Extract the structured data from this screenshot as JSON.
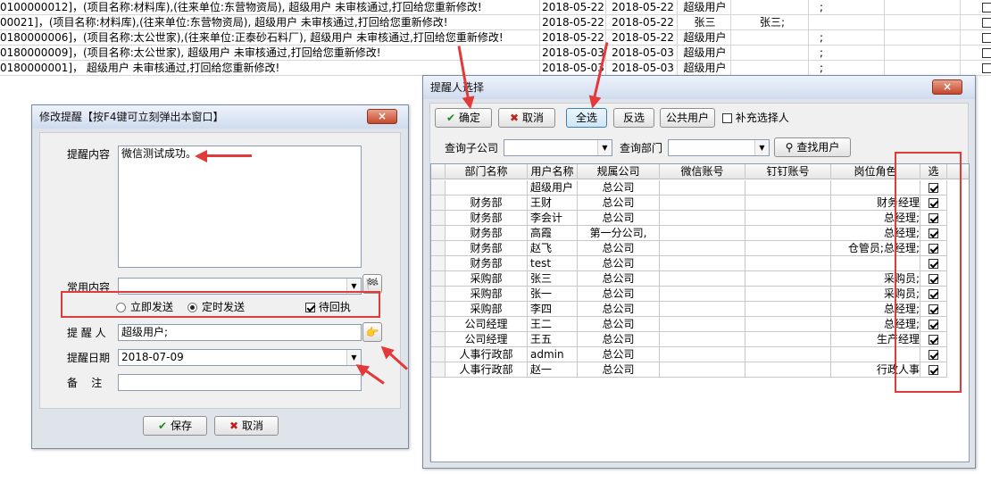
{
  "background": {
    "rows": [
      {
        "text": "0100000012]，(项目名称:材料库),(往来单位:东营物资局), 超级用户 未审核通过,打回给您重新修改!",
        "d1": "2018-05-22",
        "d2": "2018-05-22",
        "user": "超级用户",
        "c5": "",
        "c6": ";"
      },
      {
        "text": "00021]，(项目名称:材料库),(往来单位:东营物资局), 超级用户 未审核通过,打回给您重新修改!",
        "d1": "2018-05-22",
        "d2": "2018-05-22",
        "user": "张三",
        "c5": "张三;",
        "c6": ""
      },
      {
        "text": "0180000006]，(项目名称:太公世家),(往来单位:正泰砂石料厂), 超级用户 未审核通过,打回给您重新修改!",
        "d1": "2018-05-22",
        "d2": "2018-05-22",
        "user": "超级用户",
        "c5": "",
        "c6": ";"
      },
      {
        "text": "0180000009]，(项目名称:太公世家), 超级用户 未审核通过,打回给您重新修改!",
        "d1": "2018-05-03",
        "d2": "2018-05-03",
        "user": "超级用户",
        "c5": "",
        "c6": ";"
      },
      {
        "text": "0180000001]， 超级用户 未审核通过,打回给您重新修改!",
        "d1": "2018-05-03",
        "d2": "2018-05-03",
        "user": "超级用户",
        "c5": "",
        "c6": ";"
      }
    ]
  },
  "remind_dialog": {
    "title": "修改提醒【按F4键可立刻弹出本窗口】",
    "content_label": "提醒内容",
    "content_value": "微信测试成功。",
    "common_label": "常用内容",
    "common_value": "",
    "radio_now": "立即发送",
    "radio_timed": "定时发送",
    "await_receipt": "待回执",
    "reminder_label": "提 醒 人",
    "reminder_value": "超级用户;",
    "date_label": "提醒日期",
    "date_value": "2018-07-09",
    "note_label": "备    注",
    "note_value": "",
    "save_button": "保存",
    "cancel_button": "取消"
  },
  "select_dialog": {
    "title": "提醒人选择",
    "toolbar": {
      "confirm": "确定",
      "cancel": "取消",
      "select_all": "全选",
      "invert": "反选",
      "public_user": "公共用户",
      "supplement": "补充选择人"
    },
    "filter": {
      "company_label": "查询子公司",
      "dept_label": "查询部门",
      "find_button": "查找用户"
    },
    "columns": [
      "部门名称",
      "用户名称",
      "规属公司",
      "微信账号",
      "钉钉账号",
      "岗位角色",
      "选"
    ],
    "rows": [
      {
        "dept": "",
        "user": "超级用户",
        "company": "总公司",
        "wechat": "",
        "ding": "",
        "role": "",
        "checked": true
      },
      {
        "dept": "财务部",
        "user": "王财",
        "company": "总公司",
        "wechat": "",
        "ding": "",
        "role": "财务经理",
        "checked": true
      },
      {
        "dept": "财务部",
        "user": "李会计",
        "company": "总公司",
        "wechat": "",
        "ding": "",
        "role": "总经理;",
        "checked": true
      },
      {
        "dept": "财务部",
        "user": "高霞",
        "company": "第一分公司,",
        "wechat": "",
        "ding": "",
        "role": "总经理;",
        "checked": true
      },
      {
        "dept": "财务部",
        "user": "赵飞",
        "company": "总公司",
        "wechat": "",
        "ding": "",
        "role": "仓管员;总经理;",
        "checked": true
      },
      {
        "dept": "财务部",
        "user": "test",
        "company": "总公司",
        "wechat": "",
        "ding": "",
        "role": "",
        "checked": true
      },
      {
        "dept": "采购部",
        "user": "张三",
        "company": "总公司",
        "wechat": "",
        "ding": "",
        "role": "采购员;",
        "checked": true
      },
      {
        "dept": "采购部",
        "user": "张一",
        "company": "总公司",
        "wechat": "",
        "ding": "",
        "role": "采购员;",
        "checked": true
      },
      {
        "dept": "采购部",
        "user": "李四",
        "company": "总公司",
        "wechat": "",
        "ding": "",
        "role": "总经理;",
        "checked": true
      },
      {
        "dept": "公司经理",
        "user": "王二",
        "company": "总公司",
        "wechat": "",
        "ding": "",
        "role": "总经理;",
        "checked": true
      },
      {
        "dept": "公司经理",
        "user": "王五",
        "company": "总公司",
        "wechat": "",
        "ding": "",
        "role": "生产经理",
        "checked": true
      },
      {
        "dept": "人事行政部",
        "user": "admin",
        "company": "总公司",
        "wechat": "",
        "ding": "",
        "role": "",
        "checked": true
      },
      {
        "dept": "人事行政部",
        "user": "赵一",
        "company": "总公司",
        "wechat": "",
        "ding": "",
        "role": "行政人事",
        "checked": true
      }
    ]
  },
  "colors": {
    "annotation": "#e23a3a",
    "dialog_bg": "#dfe3ea",
    "title_gradient_top": "#eef3fb"
  }
}
